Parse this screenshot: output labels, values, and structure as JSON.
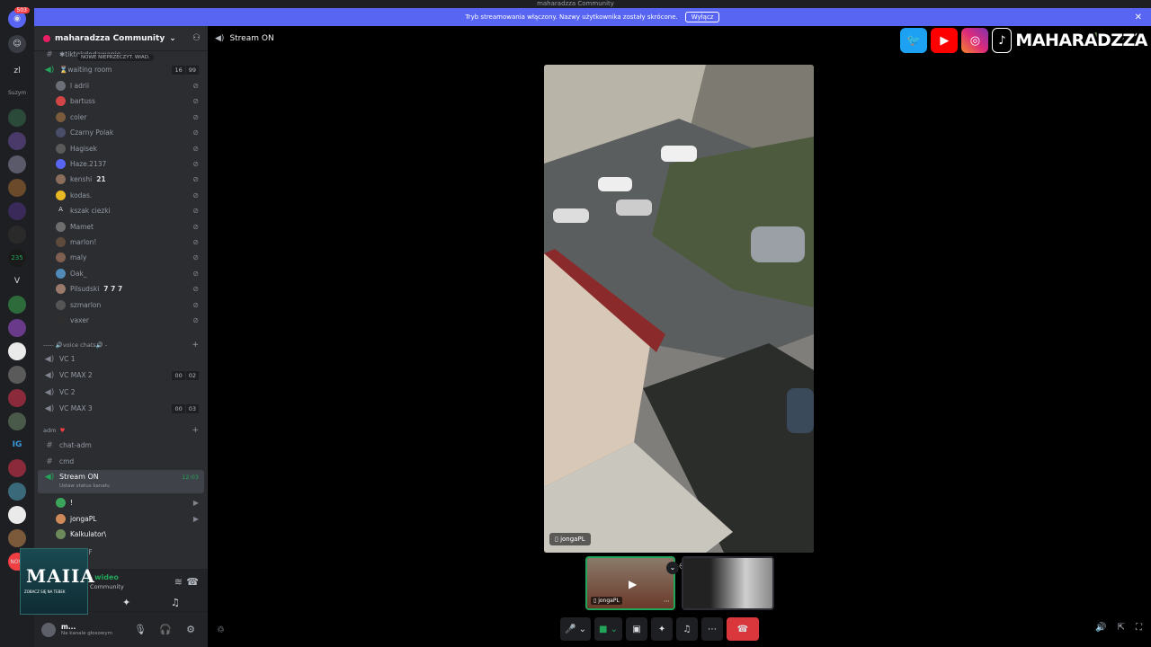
{
  "window": {
    "title": "maharadzza Community"
  },
  "banner": {
    "text": "Tryb streamowania włączony. Nazwy użytkownika zostały skrócone.",
    "button_label": "Wyłącz"
  },
  "guilds": {
    "dm_badge": "503",
    "items": [
      "zl",
      "Suzym",
      "V",
      "235",
      "IG",
      "NOW"
    ]
  },
  "server": {
    "name": "maharadzza Community",
    "unread_pill": "NOWE NIEPRZECZYT. WIAD."
  },
  "channels": {
    "top_channel": "✱tiktokdodawanie",
    "waiting_room": {
      "label": "⌛waiting room",
      "counter": [
        "16",
        "99"
      ]
    },
    "waiting_members": [
      {
        "name": "l adrii",
        "color": "#6d6f78"
      },
      {
        "name": "bartuss",
        "color": "#d04545"
      },
      {
        "name": "coler",
        "color": "#7a5c3d"
      },
      {
        "name": "Czarny Polak",
        "color": "#4a4e69"
      },
      {
        "name": "Hagisek",
        "color": "#5a5a5a"
      },
      {
        "name": "Haze.2137",
        "color": "#5865f2"
      },
      {
        "name": "kenshi",
        "color": "#8a6d5a",
        "extra": "21"
      },
      {
        "name": "kodas.",
        "color": "#e8b923"
      },
      {
        "name": "kszak ciezki",
        "color": "#2b2d31",
        "prefix": "A"
      },
      {
        "name": "Mamet",
        "color": "#6e6e6e"
      },
      {
        "name": "marlon!",
        "color": "#5d4a3a"
      },
      {
        "name": "maly",
        "color": "#7f5f50"
      },
      {
        "name": "Oak_",
        "color": "#4f8ab8"
      },
      {
        "name": "Pilsudski",
        "color": "#9a7a6a",
        "extra": "7 7 7"
      },
      {
        "name": "szmarlon",
        "color": "#555555"
      },
      {
        "name": "vaxer",
        "color": "#2e2e2e"
      }
    ],
    "voice_category": "----- 🔊voice chats🔊 -",
    "voice_channels": [
      {
        "name": "VC 1",
        "counter": null
      },
      {
        "name": "VC MAX 2",
        "counter": [
          "00",
          "02"
        ]
      },
      {
        "name": "VC 2",
        "counter": null
      },
      {
        "name": "VC MAX 3",
        "counter": [
          "00",
          "03"
        ]
      }
    ],
    "adm_category": "adm",
    "text_channels": [
      {
        "name": "chat-adm"
      },
      {
        "name": "cmd"
      }
    ],
    "active_channel": {
      "name": "Stream ON",
      "time": "12:03",
      "status": "Ustaw status kanału"
    },
    "active_members": [
      {
        "name": "!",
        "color": "#3ba55c"
      },
      {
        "name": "jongaPL",
        "color": "#d08a5a"
      },
      {
        "name": "Kalkulator\\",
        "color": "#6d8a5a"
      }
    ],
    "cut_channel": "FF"
  },
  "voice_panel": {
    "status": "m wideo",
    "server": "a Community"
  },
  "user_panel": {
    "name": "m...",
    "status": "Na kanale głosowym"
  },
  "overlay_cam": {
    "title": "MAIIA",
    "subtitle": "ZOBACZ SIĘ NA TEBEK"
  },
  "main": {
    "channel_name": "Stream ON",
    "participant_count": "3",
    "stream_owner": "jongaPL",
    "thumb1_name": "jongaPL"
  },
  "social": {
    "brand": "MAHARADZZA"
  },
  "colors": {
    "accent": "#5865f2",
    "speaking": "#23a559",
    "end_call": "#da373c"
  }
}
